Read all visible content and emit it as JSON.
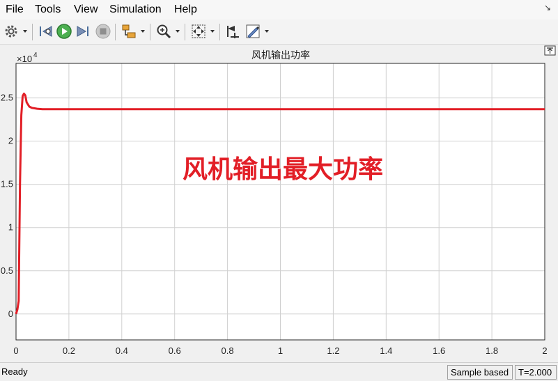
{
  "menu": {
    "file": "File",
    "tools": "Tools",
    "view": "View",
    "simulation": "Simulation",
    "help": "Help"
  },
  "toolbar": {
    "icons": [
      "settings-icon",
      "step-back-icon",
      "run-icon",
      "step-forward-icon",
      "stop-icon",
      "highlight-icon",
      "zoom-icon",
      "fit-view-icon",
      "cursor-measure-icon",
      "style-icon"
    ]
  },
  "plot": {
    "title": "风机输出功率",
    "exponent_prefix": "×10",
    "exponent": "4",
    "annotation": "风机输出最大功率",
    "line_color": "#e21e26",
    "background": "#ffffff",
    "grid_color": "#cccccc"
  },
  "chart_data": {
    "type": "line",
    "title": "风机输出功率",
    "xlabel": "",
    "ylabel": "",
    "xlim": [
      0,
      2
    ],
    "ylim": [
      -0.3,
      2.9
    ],
    "y_scale_note": "×10^4",
    "x_ticks": [
      "0",
      "0.2",
      "0.4",
      "0.6",
      "0.8",
      "1",
      "1.2",
      "1.4",
      "1.6",
      "1.8",
      "2"
    ],
    "y_ticks": [
      "0",
      "0.5",
      "1",
      "1.5",
      "2",
      "2.5"
    ],
    "grid": true,
    "series": [
      {
        "color": "#e21e26",
        "x": [
          0,
          0.005,
          0.01,
          0.015,
          0.02,
          0.025,
          0.03,
          0.035,
          0.04,
          0.05,
          0.06,
          0.08,
          0.1,
          0.15,
          0.2,
          0.5,
          1.0,
          1.5,
          2.0
        ],
        "y": [
          0,
          0.05,
          0.15,
          1.5,
          2.3,
          2.52,
          2.55,
          2.53,
          2.45,
          2.4,
          2.385,
          2.375,
          2.37,
          2.37,
          2.37,
          2.37,
          2.37,
          2.37,
          2.37
        ]
      }
    ]
  },
  "status": {
    "ready": "Ready",
    "sample": "Sample based",
    "time": "T=2.000"
  }
}
